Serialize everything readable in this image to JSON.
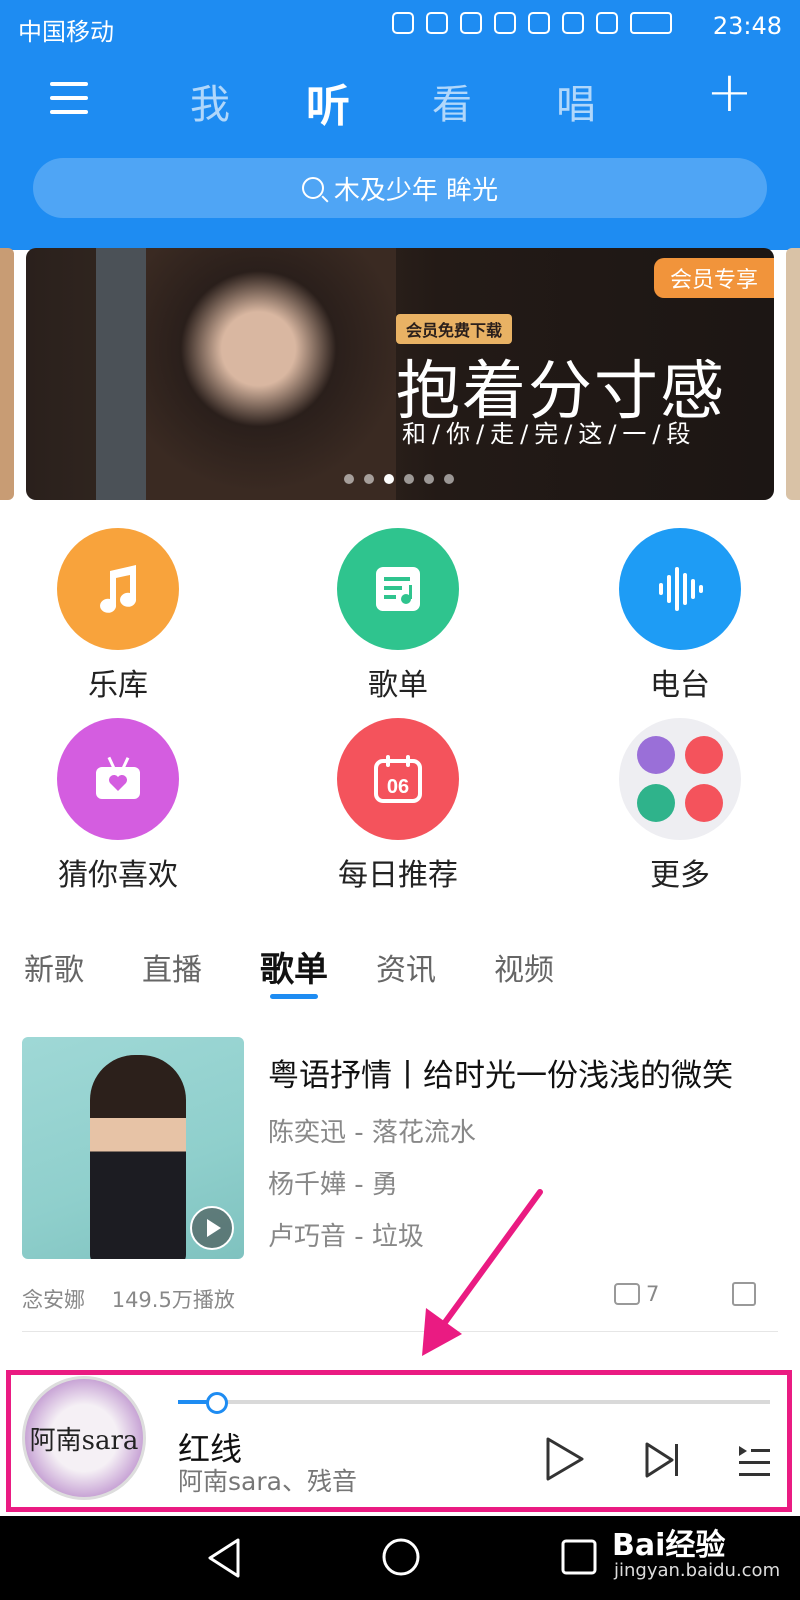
{
  "status": {
    "carrier": "中国移动",
    "time": "23:48"
  },
  "header": {
    "tabs": [
      "我",
      "听",
      "看",
      "唱"
    ],
    "active_tab": "听",
    "search_placeholder": "木及少年 眸光"
  },
  "banner": {
    "badge": "会员专享",
    "free_tag": "会员免费下载",
    "title": "抱着分寸感",
    "subtitle": "和/你/走/完/这/一/段",
    "dots": 6,
    "active_dot": 3
  },
  "categories": [
    {
      "label": "乐库",
      "color": "#f8a33c",
      "icon": "music-note-icon"
    },
    {
      "label": "歌单",
      "color": "#2fc48e",
      "icon": "playlist-icon"
    },
    {
      "label": "电台",
      "color": "#1e9cf5",
      "icon": "sound-wave-icon"
    },
    {
      "label": "猜你喜欢",
      "color": "#d45de0",
      "icon": "radio-heart-icon"
    },
    {
      "label": "每日推荐",
      "color": "#f4535c",
      "icon": "calendar-icon",
      "calendar_day": "06"
    },
    {
      "label": "更多",
      "color": "#eeeef2",
      "icon": "more-grid-icon"
    }
  ],
  "content_tabs": [
    "新歌",
    "直播",
    "歌单",
    "资讯",
    "视频"
  ],
  "active_content_tab": "歌单",
  "playlist": {
    "title": "粤语抒情丨给时光一份浅浅的微笑",
    "songs": [
      "陈奕迅 - 落花流水",
      "杨千嬅 - 勇",
      "卢巧音 - 垃圾"
    ],
    "creator": "念安娜",
    "plays": "149.5万播放",
    "comments": "7"
  },
  "player": {
    "song": "红线",
    "artist": "阿南sara、残音",
    "progress": 0.06,
    "avatar_text": "阿南sara"
  },
  "watermark": {
    "logo": "Bai经验",
    "url": "jingyan.baidu.com"
  },
  "colors": {
    "brand": "#1e8cf2",
    "highlight": "#ea1b82"
  }
}
